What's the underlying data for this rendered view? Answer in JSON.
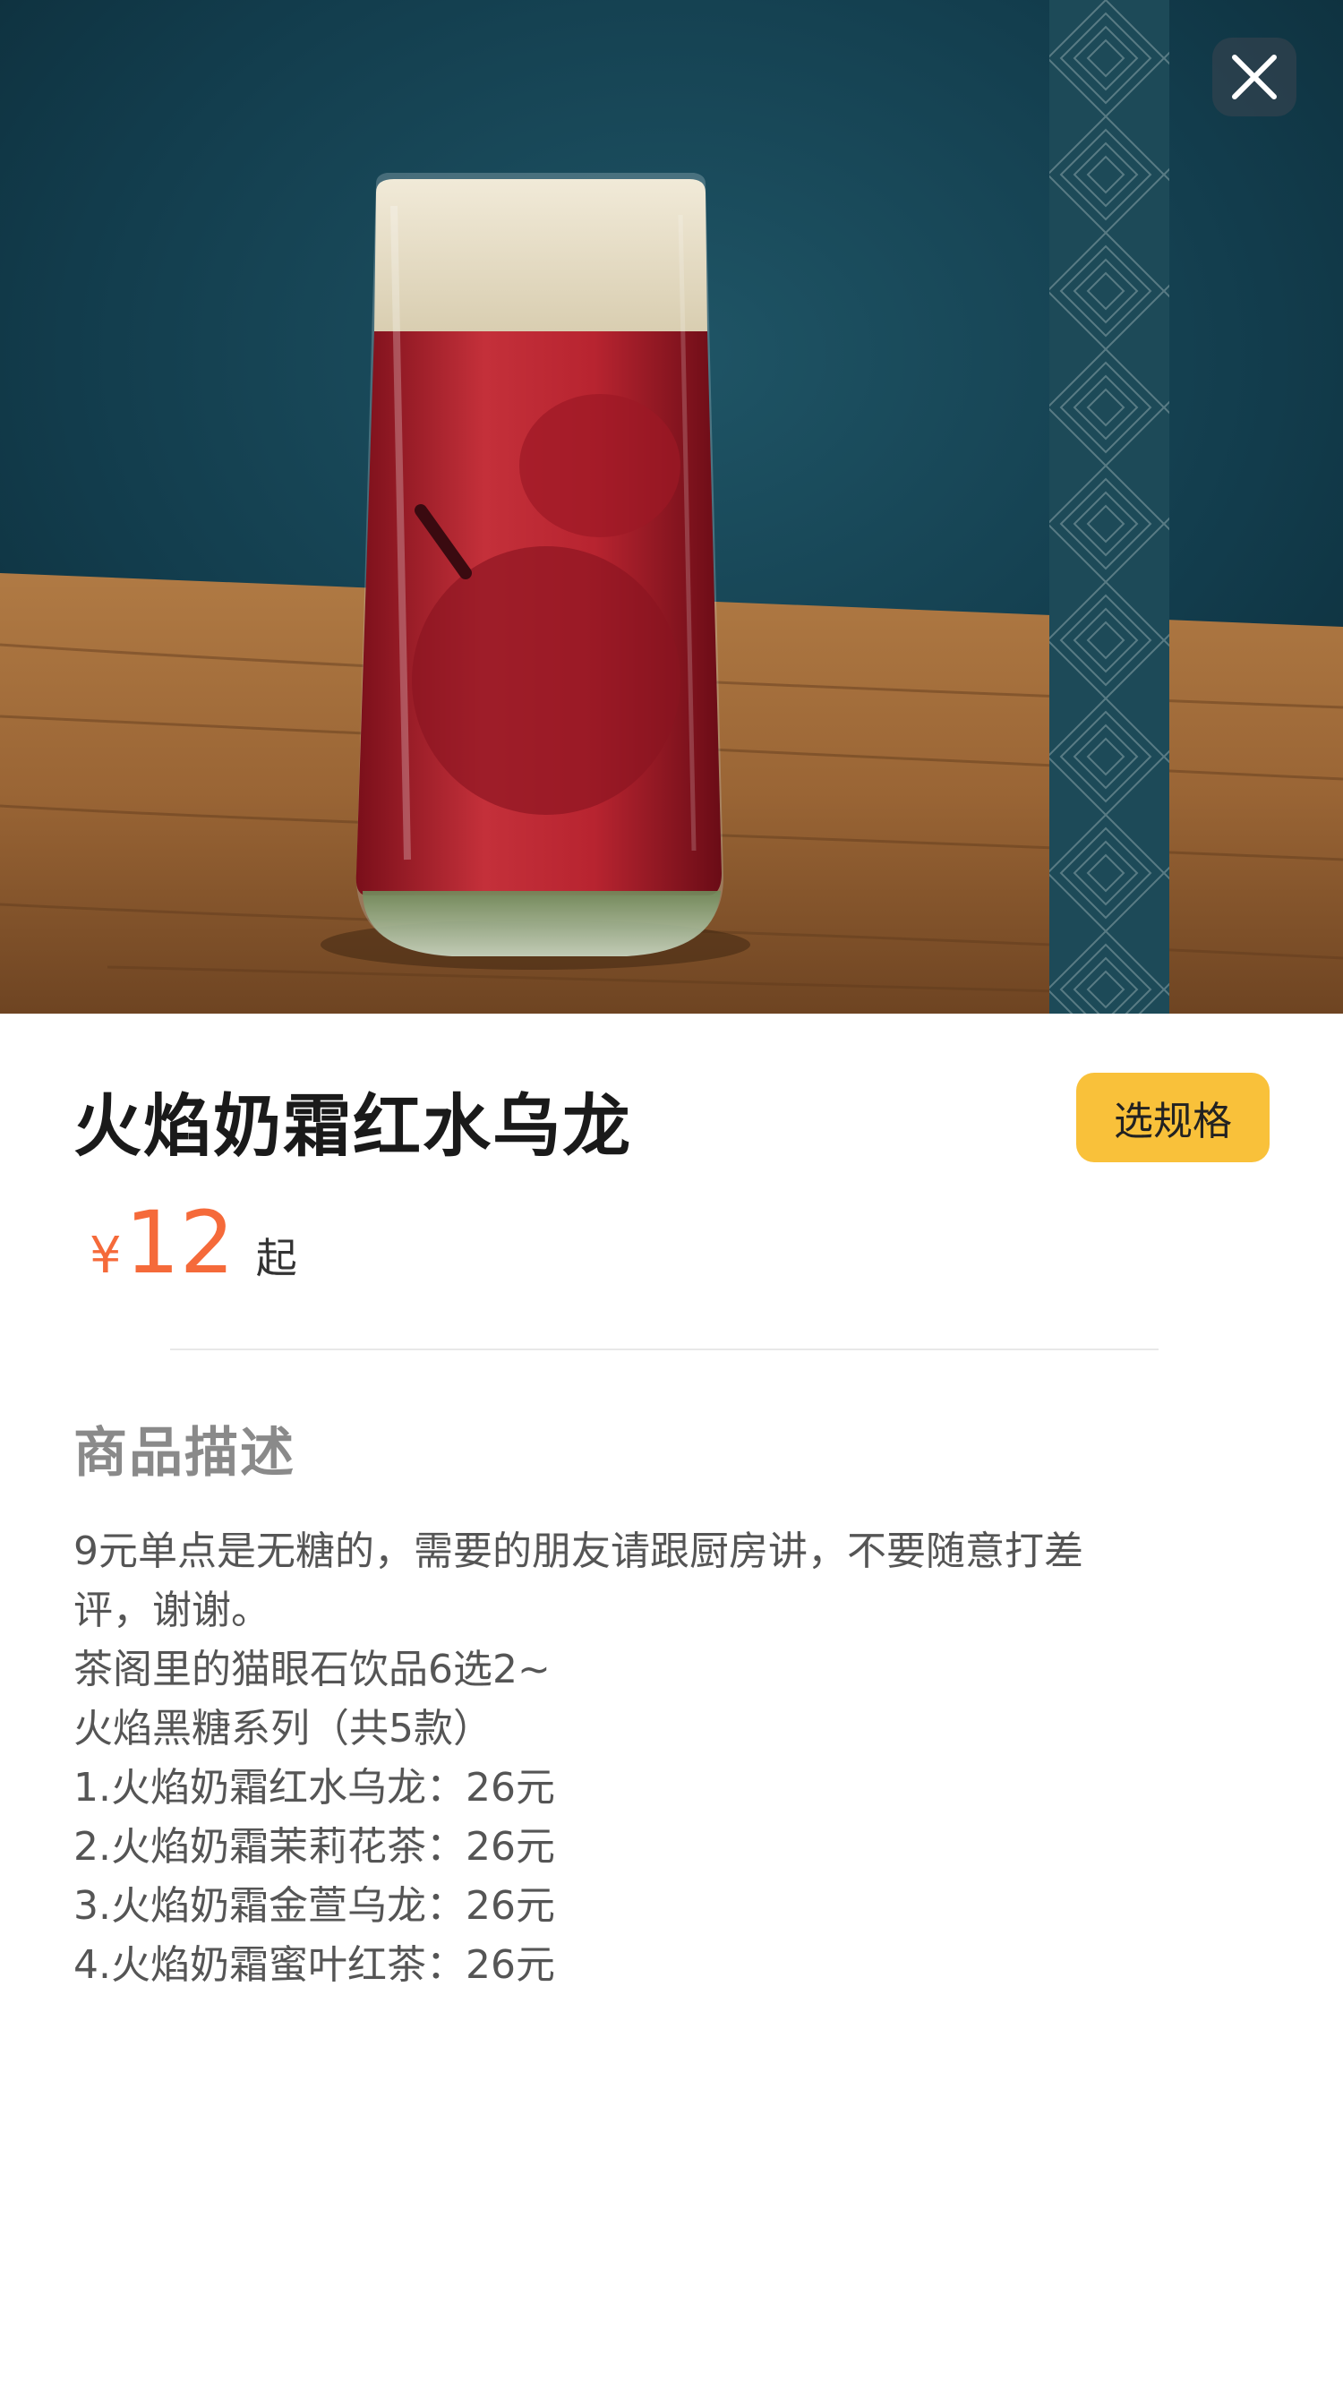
{
  "product": {
    "title": "火焰奶霜红水乌龙",
    "spec_button_label": "选规格",
    "price_currency": "¥",
    "price_amount": "12",
    "price_suffix": "起"
  },
  "description": {
    "heading": "商品描述",
    "lines": [
      "9元单点是无糖的，需要的朋友请跟厨房讲，不要随意打差",
      "评，谢谢。",
      "茶阁里的猫眼石饮品6选2~",
      "火焰黑糖系列（共5款）",
      "1.火焰奶霜红水乌龙：26元",
      "2.火焰奶霜茉莉花茶：26元",
      "3.火焰奶霜金萱乌龙：26元",
      "4.火焰奶霜蜜叶红茶：26元"
    ]
  },
  "icons": {
    "close": "close-icon"
  },
  "colors": {
    "accent": "#f9c13a",
    "price": "#f56a3a",
    "heading_gray": "#8a8a8a"
  }
}
